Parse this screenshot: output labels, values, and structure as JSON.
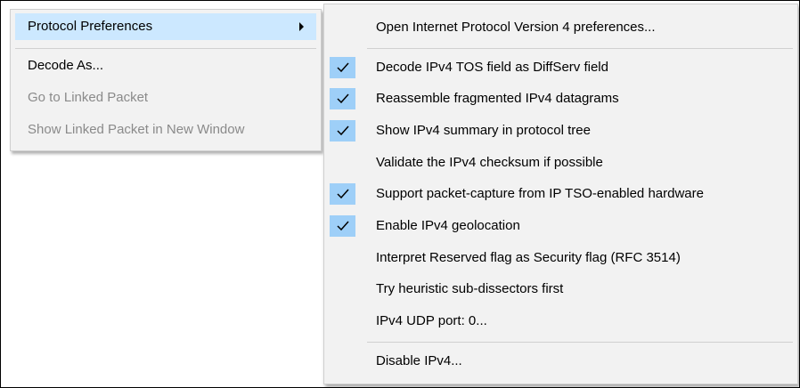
{
  "context_menu": {
    "items": [
      {
        "label": "Protocol Preferences",
        "has_submenu": true,
        "state": "highlighted"
      },
      {
        "label": "Decode As...",
        "state": "enabled"
      },
      {
        "label": "Go to Linked Packet",
        "state": "disabled"
      },
      {
        "label": "Show Linked Packet in New Window",
        "state": "disabled"
      }
    ]
  },
  "submenu": {
    "items": [
      {
        "label": "Open Internet Protocol Version 4 preferences...",
        "checked": false
      },
      {
        "label": "Decode IPv4 TOS field as DiffServ field",
        "checked": true
      },
      {
        "label": "Reassemble fragmented IPv4 datagrams",
        "checked": true
      },
      {
        "label": "Show IPv4 summary in protocol tree",
        "checked": true
      },
      {
        "label": "Validate the IPv4 checksum if possible",
        "checked": false
      },
      {
        "label": "Support packet-capture from IP TSO-enabled hardware",
        "checked": true
      },
      {
        "label": "Enable IPv4 geolocation",
        "checked": true
      },
      {
        "label": "Interpret Reserved flag as Security flag (RFC 3514)",
        "checked": false
      },
      {
        "label": "Try heuristic sub-dissectors first",
        "checked": false
      },
      {
        "label": "IPv4 UDP port: 0...",
        "checked": false
      },
      {
        "label": "Disable IPv4...",
        "checked": false
      }
    ]
  },
  "colors": {
    "highlight": "#cce8ff",
    "check_background": "#9ecff8",
    "menu_background": "#f2f2f2",
    "disabled_text": "#8a8a8a"
  },
  "icons": {
    "submenu_arrow": "chevron-right-icon",
    "check": "checkmark-icon"
  }
}
